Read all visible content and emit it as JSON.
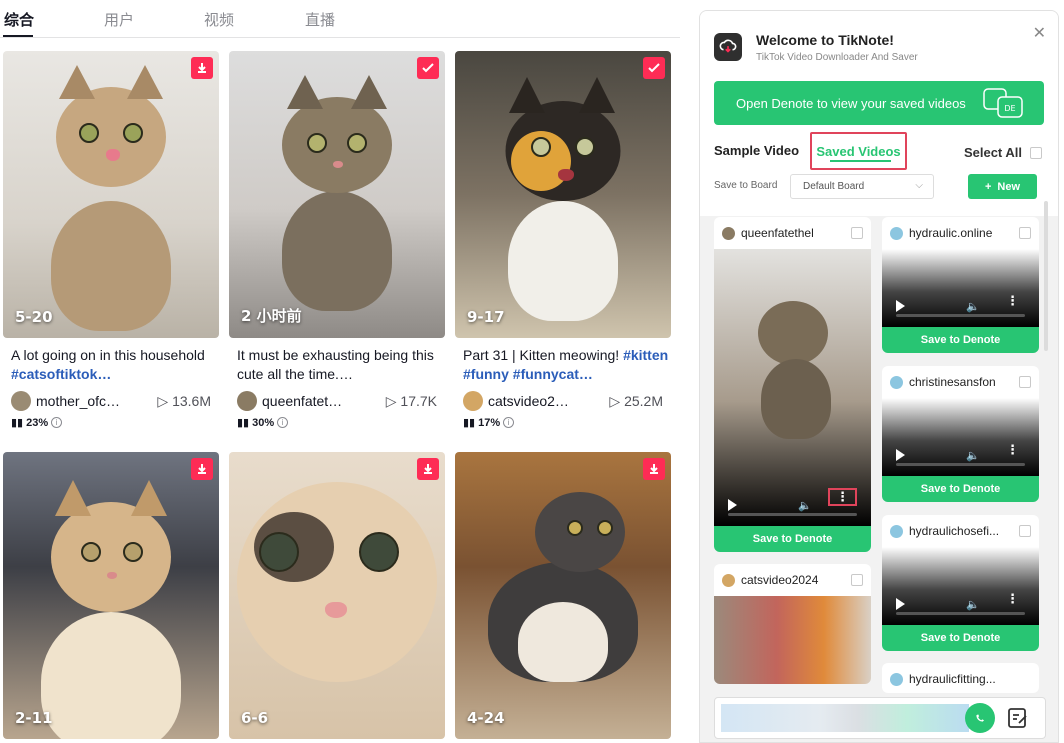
{
  "search_tabs": [
    "综合",
    "用户",
    "视频",
    "直播"
  ],
  "videos": [
    {
      "date": "5-20",
      "desc": "A lot going on in this household ",
      "tag": "#catsoftiktok…",
      "author": "mother_ofc…",
      "views": "13.6M",
      "pct": "23%",
      "badge": "download"
    },
    {
      "date": "2 小时前",
      "desc": "It must be exhausting being this cute all the time.…",
      "tag": "",
      "author": "queenfatet…",
      "views": "17.7K",
      "pct": "30%",
      "badge": "check"
    },
    {
      "date": "9-17",
      "desc": "Part 31 | Kitten meowing! ",
      "tag": "#kitten #funny #funnycat…",
      "author": "catsvideo2…",
      "views": "25.2M",
      "pct": "17%",
      "badge": "check"
    },
    {
      "date": "2-11",
      "badge": "download"
    },
    {
      "date": "6-6",
      "badge": "download"
    },
    {
      "date": "4-24",
      "badge": "download"
    }
  ],
  "panel": {
    "title": "Welcome to TikNote!",
    "subtitle": "TikTok Video Downloader And Saver",
    "open_button": "Open Denote to view your saved videos",
    "tab_sample": "Sample Video",
    "tab_saved": "Saved Videos",
    "select_all": "Select All",
    "board_label": "Save to Board",
    "board_value": "Default Board",
    "new_button": "New",
    "save_label": "Save to Denote",
    "saved": [
      {
        "user": "queenfatethel"
      },
      {
        "user": "catsvideo2024"
      },
      {
        "user": "hydraulic.online"
      },
      {
        "user": "christinesansfon"
      },
      {
        "user": "hydraulichosefi..."
      },
      {
        "user": "hydraulicfitting..."
      }
    ]
  },
  "colors": {
    "accent_green": "#28c573",
    "tiktok_red": "#fe2c55",
    "highlight_red": "#e0445b",
    "tag_blue": "#2b5db9"
  }
}
